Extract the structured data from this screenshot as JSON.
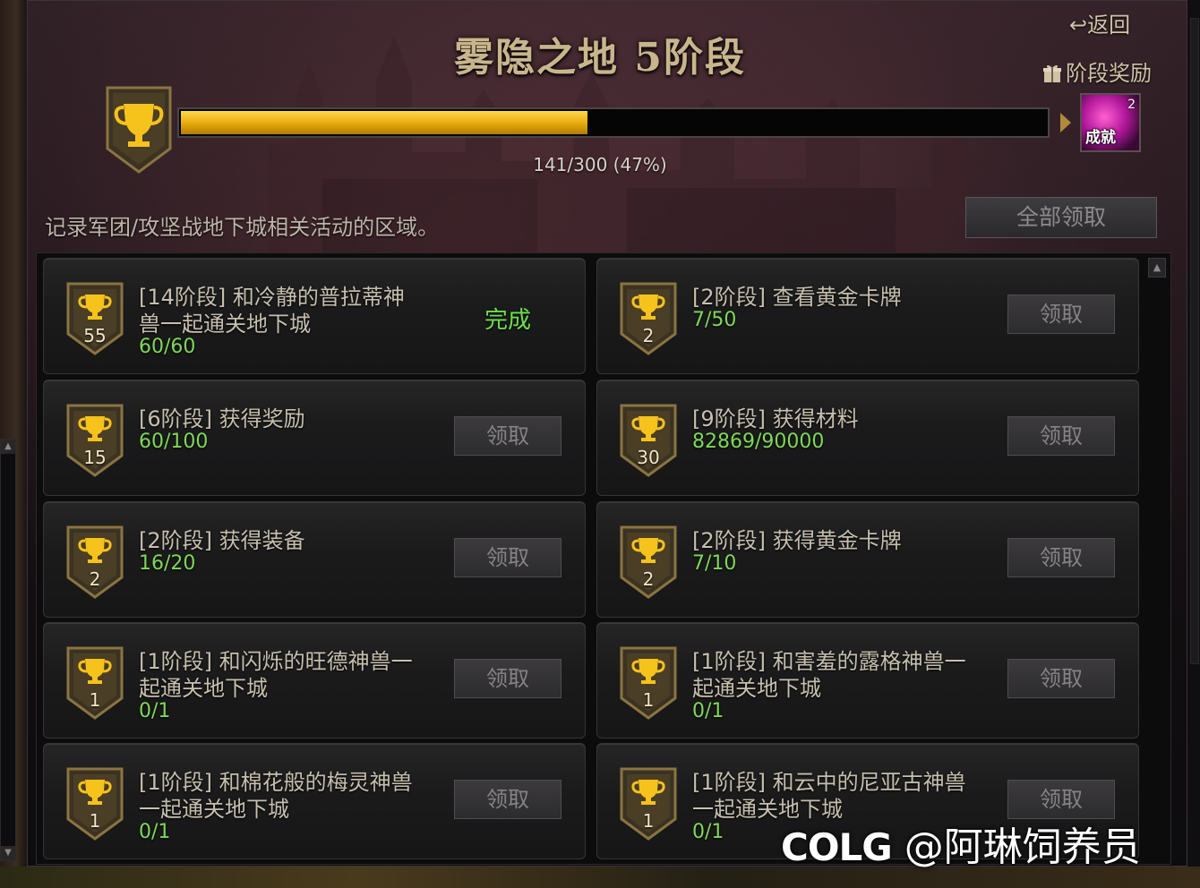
{
  "header": {
    "title": "雾隐之地 5阶段",
    "back_label": "返回",
    "stage_reward_label": "阶段奖励"
  },
  "progress": {
    "text": "141/300 (47%)",
    "fraction": 0.47,
    "reward_icon": {
      "count": "2",
      "label": "成就"
    }
  },
  "description": "记录军团/攻坚战地下城相关活动的区域。",
  "claim_all_label": "全部领取",
  "tasks": [
    {
      "badge": "55",
      "title_line1": "[14阶段] 和冷静的普拉蒂神",
      "title_line2": "兽一起通关地下城",
      "progress": "60/60",
      "status": "完成"
    },
    {
      "badge": "2",
      "title_line1": "[2阶段] 查看黄金卡牌",
      "title_line2": "",
      "progress": "7/50",
      "button": "领取"
    },
    {
      "badge": "15",
      "title_line1": "[6阶段] 获得奖励",
      "title_line2": "",
      "progress": "60/100",
      "button": "领取"
    },
    {
      "badge": "30",
      "title_line1": "[9阶段] 获得材料",
      "title_line2": "",
      "progress": "82869/90000",
      "button": "领取"
    },
    {
      "badge": "2",
      "title_line1": "[2阶段] 获得装备",
      "title_line2": "",
      "progress": "16/20",
      "button": "领取"
    },
    {
      "badge": "2",
      "title_line1": "[2阶段] 获得黄金卡牌",
      "title_line2": "",
      "progress": "7/10",
      "button": "领取"
    },
    {
      "badge": "1",
      "title_line1": "[1阶段] 和闪烁的旺德神兽一",
      "title_line2": "起通关地下城",
      "progress": "0/1",
      "button": "领取"
    },
    {
      "badge": "1",
      "title_line1": "[1阶段] 和害羞的露格神兽一",
      "title_line2": "起通关地下城",
      "progress": "0/1",
      "button": "领取"
    },
    {
      "badge": "1",
      "title_line1": "[1阶段] 和棉花般的梅灵神兽",
      "title_line2": "一起通关地下城",
      "progress": "0/1",
      "button": "领取"
    },
    {
      "badge": "1",
      "title_line1": "[1阶段] 和云中的尼亚古神兽",
      "title_line2": "一起通关地下城",
      "progress": "0/1",
      "button": "领取"
    }
  ],
  "watermark": {
    "logo": "COLG",
    "text": "@阿琳饲养员"
  },
  "colors": {
    "progress_fill": "#f2c21a",
    "progress_green": "#7ed957",
    "title_gold": "#c9b58c"
  }
}
